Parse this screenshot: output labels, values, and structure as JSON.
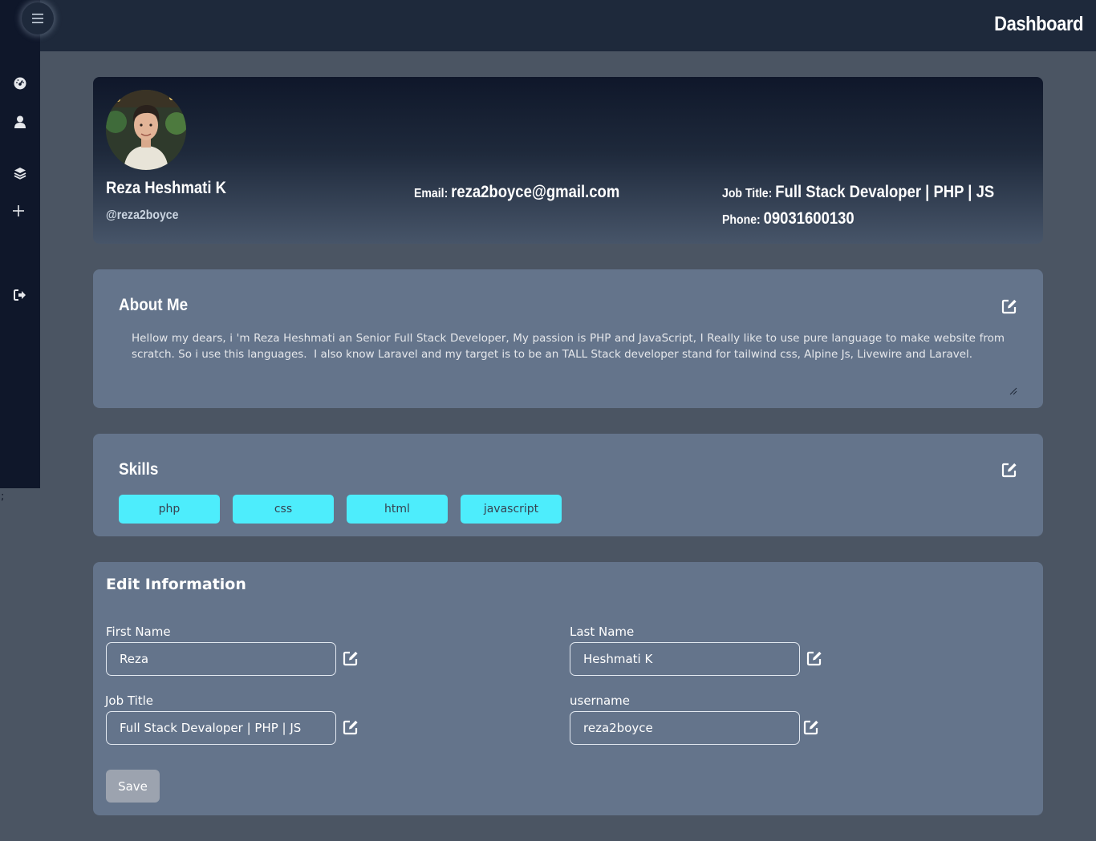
{
  "header": {
    "title": "Dashboard"
  },
  "sidebar": {
    "items": [
      {
        "icon": "tachometer-icon"
      },
      {
        "icon": "user-icon"
      },
      {
        "icon": "layers-icon"
      },
      {
        "icon": "plus-icon"
      },
      {
        "icon": "sign-out-icon"
      }
    ]
  },
  "stray_text": ";",
  "profile": {
    "name": "Reza Heshmati K",
    "username": "@reza2boyce",
    "email_label": "Email:",
    "email": "reza2boyce@gmail.com",
    "job_label": "Job Title:",
    "job": "Full Stack Devaloper | PHP | JS",
    "phone_label": "Phone:",
    "phone": "09031600130"
  },
  "about": {
    "title": "About Me",
    "text": "Hellow my dears, i 'm Reza Heshmati an Senior Full Stack Developer, My passion is PHP and JavaScript, I Really like to use pure language to make website from scratch. So i use this languages.  I also know Laravel and my target is to be an TALL Stack developer stand for tailwind css, Alpine Js, Livewire and Laravel."
  },
  "skills": {
    "title": "Skills",
    "items": [
      "php",
      "css",
      "html",
      "javascript"
    ],
    "pill_color": "#4dedfc"
  },
  "edit": {
    "title": "Edit Information",
    "first_name_label": "First Name",
    "first_name": "Reza",
    "last_name_label": "Last Name",
    "last_name": "Heshmati K",
    "job_title_label": "Job Title",
    "job_title": "Full Stack Devaloper | PHP | JS",
    "username_label": "username",
    "username": "reza2boyce",
    "save_label": "Save"
  },
  "colors": {
    "background": "#4b5563",
    "topbar": "#1e293b",
    "sidebar": "#0f172a",
    "card": "#64748b"
  }
}
